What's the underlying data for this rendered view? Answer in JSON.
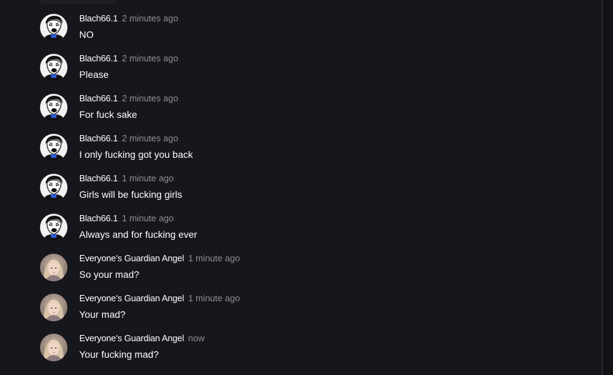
{
  "messages": [
    {
      "author": "Blach66.1",
      "time": "2 minutes ago",
      "text": "NO",
      "avatar_icon": "retro-man-avatar"
    },
    {
      "author": "Blach66.1",
      "time": "2 minutes ago",
      "text": "Please",
      "avatar_icon": "retro-man-avatar"
    },
    {
      "author": "Blach66.1",
      "time": "2 minutes ago",
      "text": "For fuck sake",
      "avatar_icon": "retro-man-avatar"
    },
    {
      "author": "Blach66.1",
      "time": "2 minutes ago",
      "text": "I only fucking got you back",
      "avatar_icon": "retro-man-avatar"
    },
    {
      "author": "Blach66.1",
      "time": "1 minute ago",
      "text": "Girls will be fucking girls",
      "avatar_icon": "retro-man-avatar"
    },
    {
      "author": "Blach66.1",
      "time": "1 minute ago",
      "text": "Always and for fucking ever",
      "avatar_icon": "retro-man-avatar"
    },
    {
      "author": "Everyone's Guardian Angel",
      "time": "1 minute ago",
      "text": "So your mad?",
      "avatar_icon": "angel-girl-avatar"
    },
    {
      "author": "Everyone's Guardian Angel",
      "time": "1 minute ago",
      "text": "Your mad?",
      "avatar_icon": "angel-girl-avatar"
    },
    {
      "author": "Everyone's Guardian Angel",
      "time": "now",
      "text": "Your fucking mad?",
      "avatar_icon": "angel-girl-avatar"
    }
  ],
  "colors": {
    "background": "#16171c",
    "author": "#ffffff",
    "timestamp": "#8e9097",
    "message_text": "#ffffff"
  }
}
